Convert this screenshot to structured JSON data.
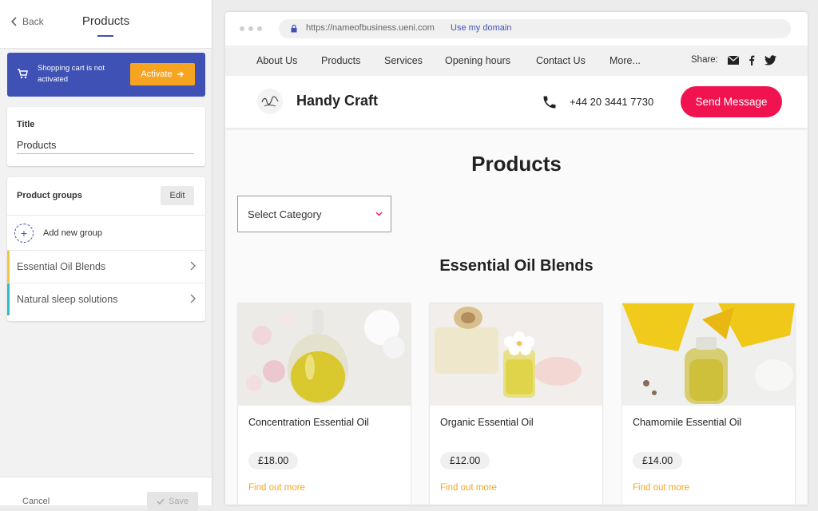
{
  "editor": {
    "back_label": "Back",
    "title": "Products",
    "cart_banner": {
      "message": "Shopping cart is not activated",
      "activate_label": "Activate"
    },
    "title_field": {
      "label": "Title",
      "value": "Products"
    },
    "product_groups": {
      "header": "Product groups",
      "edit_label": "Edit",
      "add_label": "Add new group",
      "items": [
        {
          "label": "Essential Oil Blends",
          "color": "#f5c342"
        },
        {
          "label": "Natural sleep solutions",
          "color": "#36b9cc"
        }
      ]
    },
    "footer": {
      "cancel_label": "Cancel",
      "save_label": "Save"
    }
  },
  "browser": {
    "url": "https://nameofbusiness.ueni.com",
    "domain_link": "Use my domain"
  },
  "site": {
    "nav": [
      "About Us",
      "Products",
      "Services",
      "Opening hours",
      "Contact Us",
      "More..."
    ],
    "share_label": "Share:",
    "social_icons": [
      "email-icon",
      "facebook-icon",
      "twitter-icon"
    ],
    "brand": "Handy Craft",
    "phone": "+44 20 3441 7730",
    "send_label": "Send Message",
    "page_title": "Products",
    "category_select": "Select Category",
    "group_title": "Essential Oil Blends",
    "products": [
      {
        "name": "Concentration Essential Oil",
        "price": "£18.00",
        "link": "Find out more"
      },
      {
        "name": "Organic Essential Oil",
        "price": "£12.00",
        "link": "Find out more"
      },
      {
        "name": "Chamomile Essential Oil",
        "price": "£14.00",
        "link": "Find out more"
      }
    ]
  },
  "colors": {
    "primary": "#3f51b5",
    "activate": "#f7a521",
    "send": "#f0134f",
    "link": "#f5a623"
  }
}
